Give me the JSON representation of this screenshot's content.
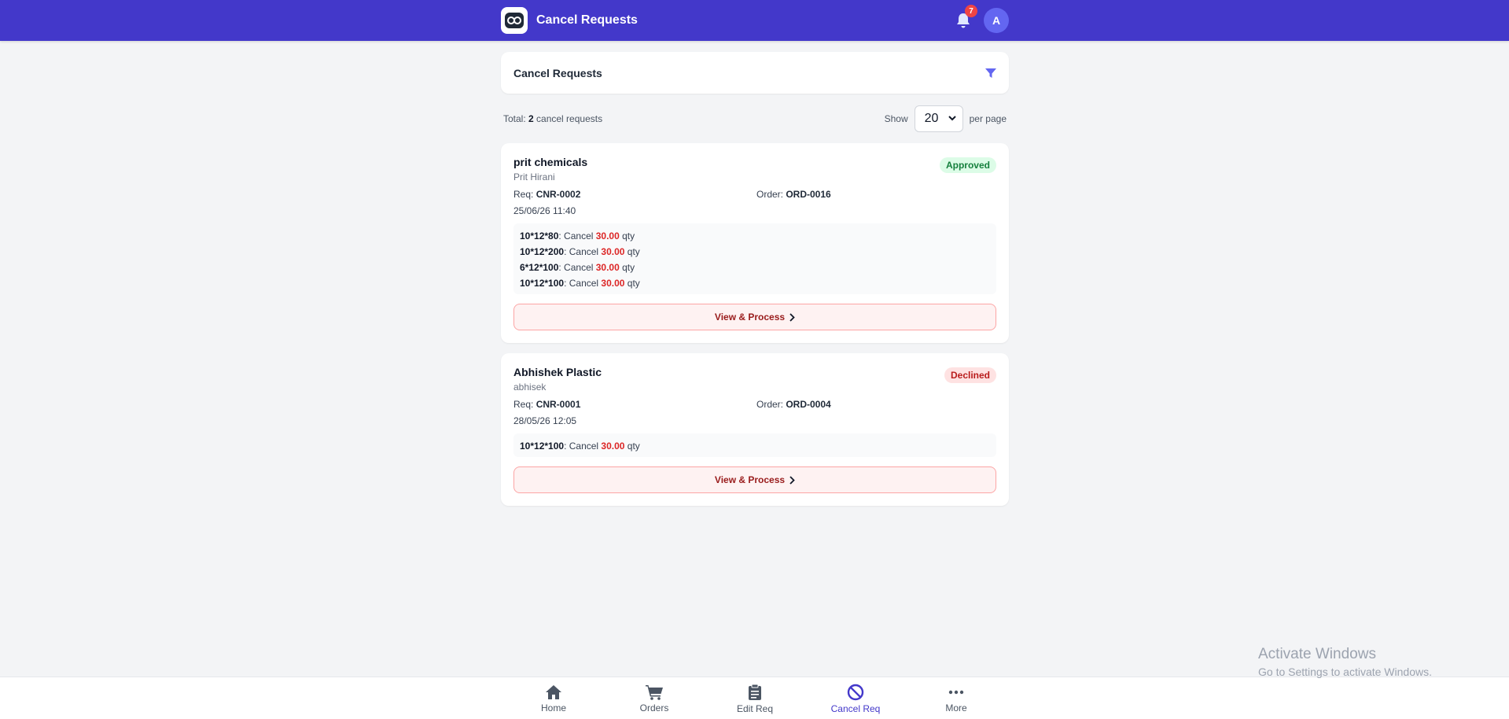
{
  "header": {
    "title": "Cancel Requests",
    "notification_count": "7",
    "avatar_initial": "A"
  },
  "page": {
    "card_title": "Cancel Requests",
    "total_prefix": "Total: ",
    "total_count": "2",
    "total_suffix": " cancel requests",
    "show_label": "Show",
    "per_page_value": "20",
    "per_page_label": "per page"
  },
  "requests": [
    {
      "company": "prit chemicals",
      "person": "Prit Hirani",
      "status": "Approved",
      "req_label": "Req: ",
      "req_id": "CNR-0002",
      "order_label": "Order: ",
      "order_id": "ORD-0016",
      "date": "25/06/26 11:40",
      "items": [
        {
          "size": "10*12*80",
          "text": ": Cancel ",
          "qty": "30.00",
          "unit": " qty"
        },
        {
          "size": "10*12*200",
          "text": ": Cancel ",
          "qty": "30.00",
          "unit": " qty"
        },
        {
          "size": "6*12*100",
          "text": ": Cancel ",
          "qty": "30.00",
          "unit": " qty"
        },
        {
          "size": "10*12*100",
          "text": ": Cancel ",
          "qty": "30.00",
          "unit": " qty"
        }
      ],
      "action_label": "View & Process"
    },
    {
      "company": "Abhishek Plastic",
      "person": "abhisek",
      "status": "Declined",
      "req_label": "Req: ",
      "req_id": "CNR-0001",
      "order_label": "Order: ",
      "order_id": "ORD-0004",
      "date": "28/05/26 12:05",
      "items": [
        {
          "size": "10*12*100",
          "text": ": Cancel ",
          "qty": "30.00",
          "unit": " qty"
        }
      ],
      "action_label": "View & Process"
    }
  ],
  "nav": {
    "items": [
      {
        "label": "Home",
        "icon": "home-icon"
      },
      {
        "label": "Orders",
        "icon": "cart-icon"
      },
      {
        "label": "Edit Req",
        "icon": "clipboard-icon"
      },
      {
        "label": "Cancel Req",
        "icon": "ban-icon"
      },
      {
        "label": "More",
        "icon": "more-icon"
      }
    ],
    "active": "Cancel Req"
  },
  "watermark": {
    "line1": "Activate Windows",
    "line2": "Go to Settings to activate Windows."
  },
  "colors": {
    "brand": "#4338ca",
    "approved": "#15803d",
    "declined": "#b91c1c",
    "qty": "#dc2626"
  }
}
